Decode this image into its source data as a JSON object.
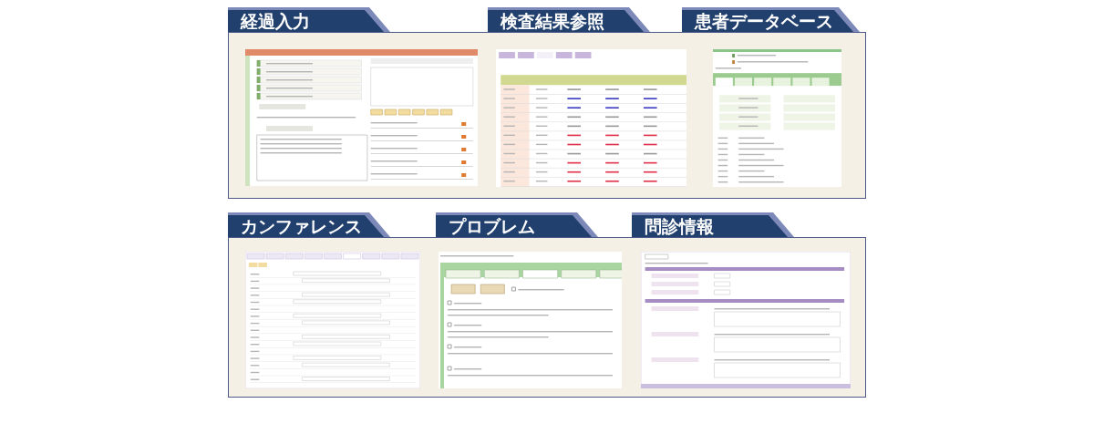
{
  "rows": [
    {
      "sections": [
        {
          "title": "経過入力",
          "kind": "progress"
        },
        {
          "title": "検査結果参照",
          "kind": "lab"
        },
        {
          "title": "患者データベース",
          "kind": "database"
        }
      ]
    },
    {
      "sections": [
        {
          "title": "カンファレンス",
          "kind": "conference"
        },
        {
          "title": "プロブレム",
          "kind": "problem"
        },
        {
          "title": "問診情報",
          "kind": "interview"
        }
      ]
    }
  ]
}
